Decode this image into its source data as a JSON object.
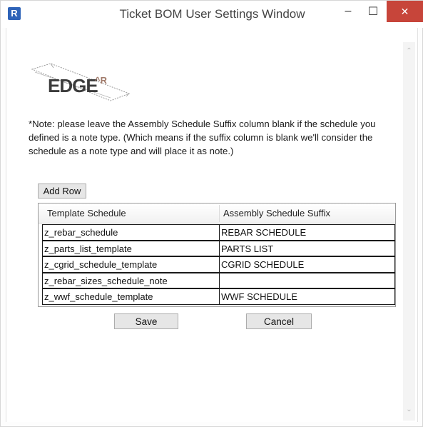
{
  "window": {
    "app_icon": "R",
    "title": "Ticket BOM User Settings Window",
    "minimize_glyph": "–",
    "maximize_glyph": "☐",
    "close_glyph": "✕"
  },
  "logo": {
    "text": "EDGE",
    "suffix": "^R"
  },
  "note": "*Note: please leave the Assembly Schedule Suffix column blank if the schedule you defined is a note type. (Which means if the suffix column is blank we'll consider the schedule as a note type and will place it as note.)",
  "add_row_label": "Add Row",
  "grid": {
    "headers": [
      "Template Schedule",
      "Assembly Schedule Suffix"
    ],
    "rows": [
      {
        "template": "z_rebar_schedule",
        "suffix": "REBAR SCHEDULE"
      },
      {
        "template": "z_parts_list_template",
        "suffix": "PARTS LIST"
      },
      {
        "template": "z_cgrid_schedule_template",
        "suffix": "CGRID SCHEDULE"
      },
      {
        "template": "z_rebar_sizes_schedule_note",
        "suffix": ""
      },
      {
        "template": "z_wwf_schedule_template",
        "suffix": "WWF SCHEDULE"
      }
    ]
  },
  "buttons": {
    "save": "Save",
    "cancel": "Cancel"
  },
  "scrollbar": {
    "up_glyph": "⌃",
    "down_glyph": "⌄"
  },
  "colors": {
    "close_button": "#c7453a",
    "app_icon": "#2e63b8"
  }
}
